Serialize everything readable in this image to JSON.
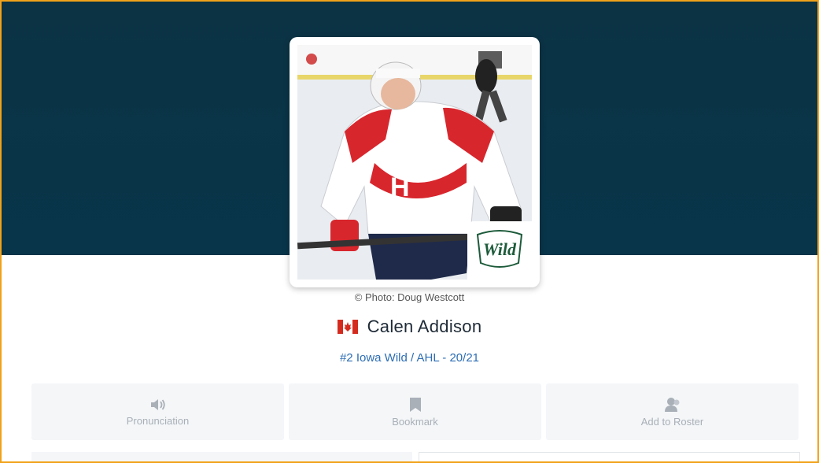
{
  "photo": {
    "credit": "© Photo: Doug Westcott",
    "team_logo_text": "Wild"
  },
  "player": {
    "flag": "canada-flag",
    "name": "Calen Addison",
    "team_line": "#2 Iowa Wild / AHL - 20/21"
  },
  "actions": [
    {
      "label": "Pronunciation",
      "icon": "speaker-icon"
    },
    {
      "label": "Bookmark",
      "icon": "bookmark-icon"
    },
    {
      "label": "Add to Roster",
      "icon": "user-add-icon"
    }
  ],
  "colors": {
    "hero": "#08354a",
    "accent_link": "#2c6db4",
    "frame_border": "#f0a21a"
  }
}
